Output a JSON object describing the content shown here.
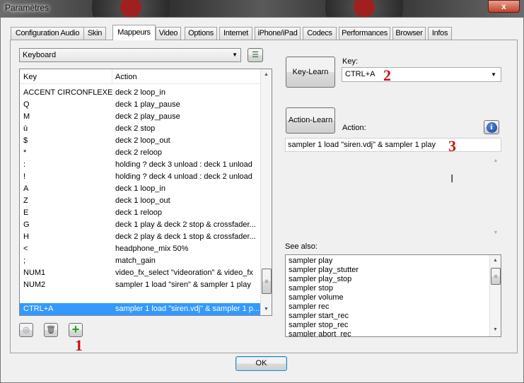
{
  "window": {
    "title": "Paramètres",
    "close_label": "x"
  },
  "tabs": [
    "Configuration Audio",
    "Skin",
    "Mappeurs",
    "Video",
    "Options",
    "Internet",
    "iPhone/iPad",
    "Codecs",
    "Performances",
    "Browser",
    "Infos"
  ],
  "active_tab": "Mappeurs",
  "mapper_select": "Keyboard",
  "table": {
    "headers": {
      "key": "Key",
      "action": "Action"
    },
    "rows": [
      {
        "key": "ACCENT CIRCONFLEXE",
        "action": "deck 2 loop_in"
      },
      {
        "key": "Q",
        "action": "deck 1 play_pause"
      },
      {
        "key": "M",
        "action": "deck 2 play_pause"
      },
      {
        "key": "ù",
        "action": "deck 2 stop"
      },
      {
        "key": "$",
        "action": "deck 2 loop_out"
      },
      {
        "key": "*",
        "action": "deck 2 reloop"
      },
      {
        "key": ":",
        "action": "holding ? deck 3 unload : deck 1 unload"
      },
      {
        "key": "!",
        "action": "holding ? deck 4 unload : deck 2 unload"
      },
      {
        "key": "A",
        "action": "deck 1 loop_in"
      },
      {
        "key": "Z",
        "action": "deck 1 loop_out"
      },
      {
        "key": "E",
        "action": "deck 1 reloop"
      },
      {
        "key": "G",
        "action": "deck 1 play & deck 2 stop & crossfader..."
      },
      {
        "key": "H",
        "action": "deck 2 play & deck 1 stop & crossfader..."
      },
      {
        "key": "<",
        "action": "headphone_mix 50%"
      },
      {
        "key": ";",
        "action": "match_gain"
      },
      {
        "key": "NUM1",
        "action": " video_fx_select \"videoration\" & video_fx"
      },
      {
        "key": "NUM2",
        "action": "sampler 1 load \"siren\" & sampler 1 play"
      },
      {
        "key": "",
        "action": ""
      },
      {
        "key": "CTRL+A",
        "action": "sampler 1 load \"siren.vdj\" & sampler 1 p..."
      }
    ],
    "selected_index": 18
  },
  "annotations": {
    "one": "1",
    "two": "2",
    "three": "3"
  },
  "key_learn_label": "Key-Learn",
  "key_label": "Key:",
  "key_value": "CTRL+A",
  "action_learn_label": "Action-Learn",
  "action_label": "Action:",
  "action_value": "sampler 1 load \"siren.vdj\" & sampler 1 play",
  "see_also_label": "See also:",
  "see_also": [
    "sampler play",
    "sampler play_stutter",
    "sampler play_stop",
    "sampler stop",
    "sampler volume",
    "sampler rec",
    "sampler start_rec",
    "sampler stop_rec",
    "sampler abort_rec"
  ],
  "ok_label": "OK",
  "colors": {
    "selection": "#3399ff",
    "annotation": "#d01010"
  }
}
